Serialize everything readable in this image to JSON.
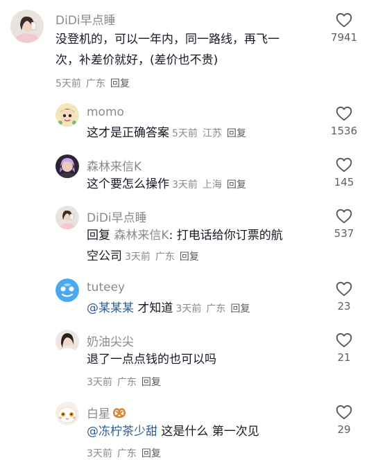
{
  "comments": [
    {
      "username": "DiDi早点睡",
      "text_line1": "没登机的，可以一年内，同一路线，再飞一",
      "text_line2": "次，补差价就好，(差价也不贵)",
      "time": "5天前",
      "location": "广东",
      "reply_label": "回复",
      "likes": "7941"
    },
    {
      "username": "momo",
      "text": "这才是正确答案",
      "time": "5天前",
      "location": "江苏",
      "reply_label": "回复",
      "likes": "1536"
    },
    {
      "username": "森林来信K",
      "text": "这个要怎么操作",
      "time": "3天前",
      "location": "上海",
      "reply_label": "回复",
      "likes": "145"
    },
    {
      "username": "DiDi早点睡",
      "reply_prefix": "回复",
      "reply_to": "森林来信K",
      "text_line1": ": 打电话给你订票的航",
      "text_line2": "空公司",
      "time": "3天前",
      "location": "广东",
      "reply_label": "回复",
      "likes": "537"
    },
    {
      "username": "tuteey",
      "mention": "@某某某",
      "text": "才知道",
      "time": "3天前",
      "location": "广东",
      "reply_label": "回复",
      "likes": "23"
    },
    {
      "username": "奶油尖尖",
      "text": "退了一点点钱的也可以吗",
      "time": "3天前",
      "location": "广东",
      "reply_label": "回复",
      "likes": "21"
    },
    {
      "username": "白星",
      "mention": "@冻柠茶少甜",
      "text": "这是什么 第一次见",
      "time": "3天前",
      "location": "广东",
      "reply_label": "回复",
      "likes": "29"
    }
  ]
}
